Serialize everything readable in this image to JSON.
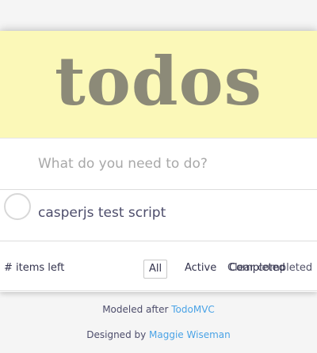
{
  "header": {
    "title": "todos"
  },
  "new_todo": {
    "placeholder": "What do you need to do?",
    "value": ""
  },
  "todos": [
    {
      "label": "casperjs test script",
      "completed": false
    }
  ],
  "footer": {
    "count_text": "# items left",
    "filters": {
      "all": "All",
      "active": "Active",
      "completed": "Completed"
    },
    "clear_completed": "Clear completed"
  },
  "info": {
    "modeled_prefix": "Modeled after ",
    "modeled_link": "TodoMVC",
    "designed_prefix": "Designed by ",
    "designed_link": "Maggie Wiseman"
  },
  "colors": {
    "header_bg": "#fbf8b8",
    "title": "#8c8a78",
    "link": "#4aa3e6"
  }
}
